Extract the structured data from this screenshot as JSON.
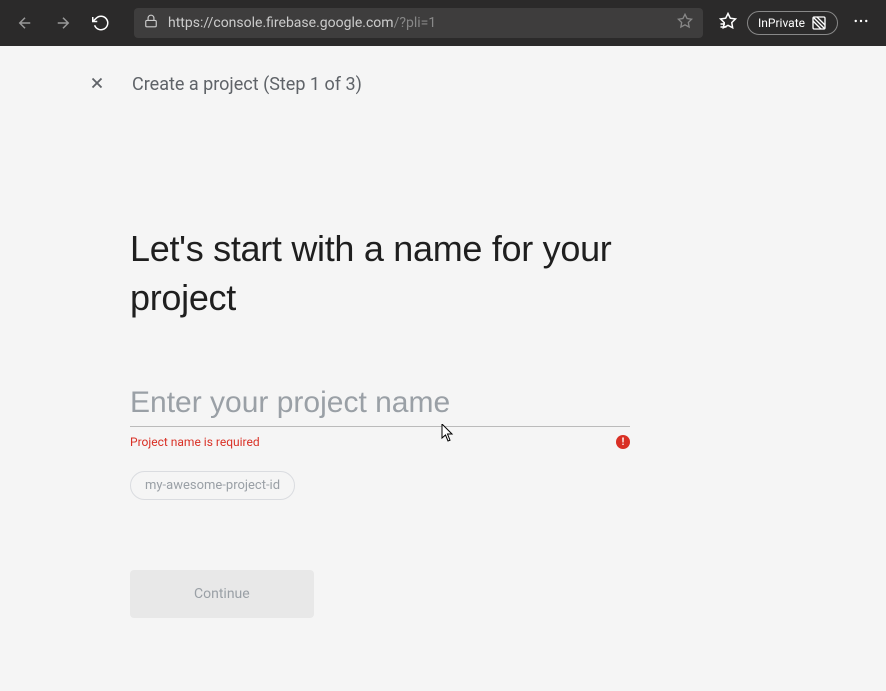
{
  "browser": {
    "url_host": "https://console.firebase.google.com",
    "url_path": "/?pli=1",
    "inprivate_label": "InPrivate"
  },
  "wizard": {
    "title": "Create a project (Step 1 of 3)",
    "heading": "Let's start with a name for your project",
    "input_placeholder": "Enter your project name",
    "input_value": "",
    "error_message": "Project name is required",
    "error_icon_glyph": "!",
    "project_id_hint": "my-awesome-project-id",
    "continue_label": "Continue"
  }
}
